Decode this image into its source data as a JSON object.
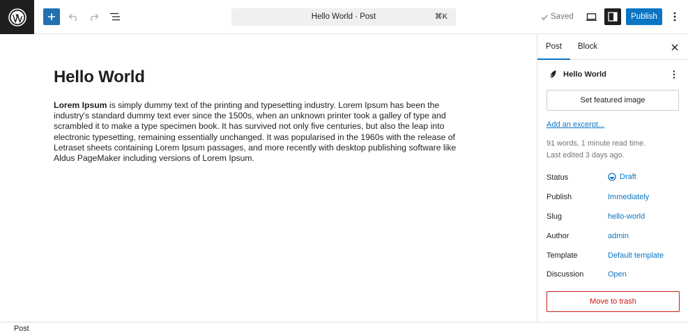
{
  "toolbar": {
    "logo_icon": "wordpress-logo",
    "add_icon": "plus-icon",
    "undo_icon": "undo-icon",
    "redo_icon": "redo-icon",
    "outline_icon": "document-overview-icon",
    "command_title": "Hello World · Post",
    "command_shortcut": "⌘K",
    "saved_label": "Saved",
    "preview_icon": "desktop-icon",
    "settings_icon": "sidebar-toggle-icon",
    "publish_label": "Publish",
    "options_icon": "more-vertical-icon",
    "accent_color": "#0a75c2"
  },
  "editor": {
    "title": "Hello World",
    "body_bold": "Lorem Ipsum",
    "body_rest": " is simply dummy text of the printing and typesetting industry. Lorem Ipsum has been the industry's standard dummy text ever since the 1500s, when an unknown printer took a galley of type and scrambled it to make a type specimen book. It has survived not only five centuries, but also the leap into electronic typesetting, remaining essentially unchanged. It was popularised in the 1960s with the release of Letraset sheets containing Lorem Ipsum passages, and more recently with desktop publishing software like Aldus PageMaker including versions of Lorem Ipsum."
  },
  "sidebar": {
    "tabs": [
      {
        "label": "Post",
        "active": true
      },
      {
        "label": "Block",
        "active": false
      }
    ],
    "close_icon": "close-icon",
    "post_card": {
      "icon": "feather-icon",
      "title": "Hello World"
    },
    "featured_image_label": "Set featured image",
    "excerpt_link": "Add an excerpt...",
    "word_count": "91 words, 1 minute read time.",
    "last_edited": "Last edited 3 days ago.",
    "rows": [
      {
        "label": "Status",
        "value": "Draft"
      },
      {
        "label": "Publish",
        "value": "Immediately"
      },
      {
        "label": "Slug",
        "value": "hello-world"
      },
      {
        "label": "Author",
        "value": "admin"
      },
      {
        "label": "Template",
        "value": "Default template"
      },
      {
        "label": "Discussion",
        "value": "Open"
      }
    ],
    "trash_label": "Move to trash",
    "danger_color": "#cc1818"
  },
  "footer": {
    "breadcrumb": "Post"
  }
}
